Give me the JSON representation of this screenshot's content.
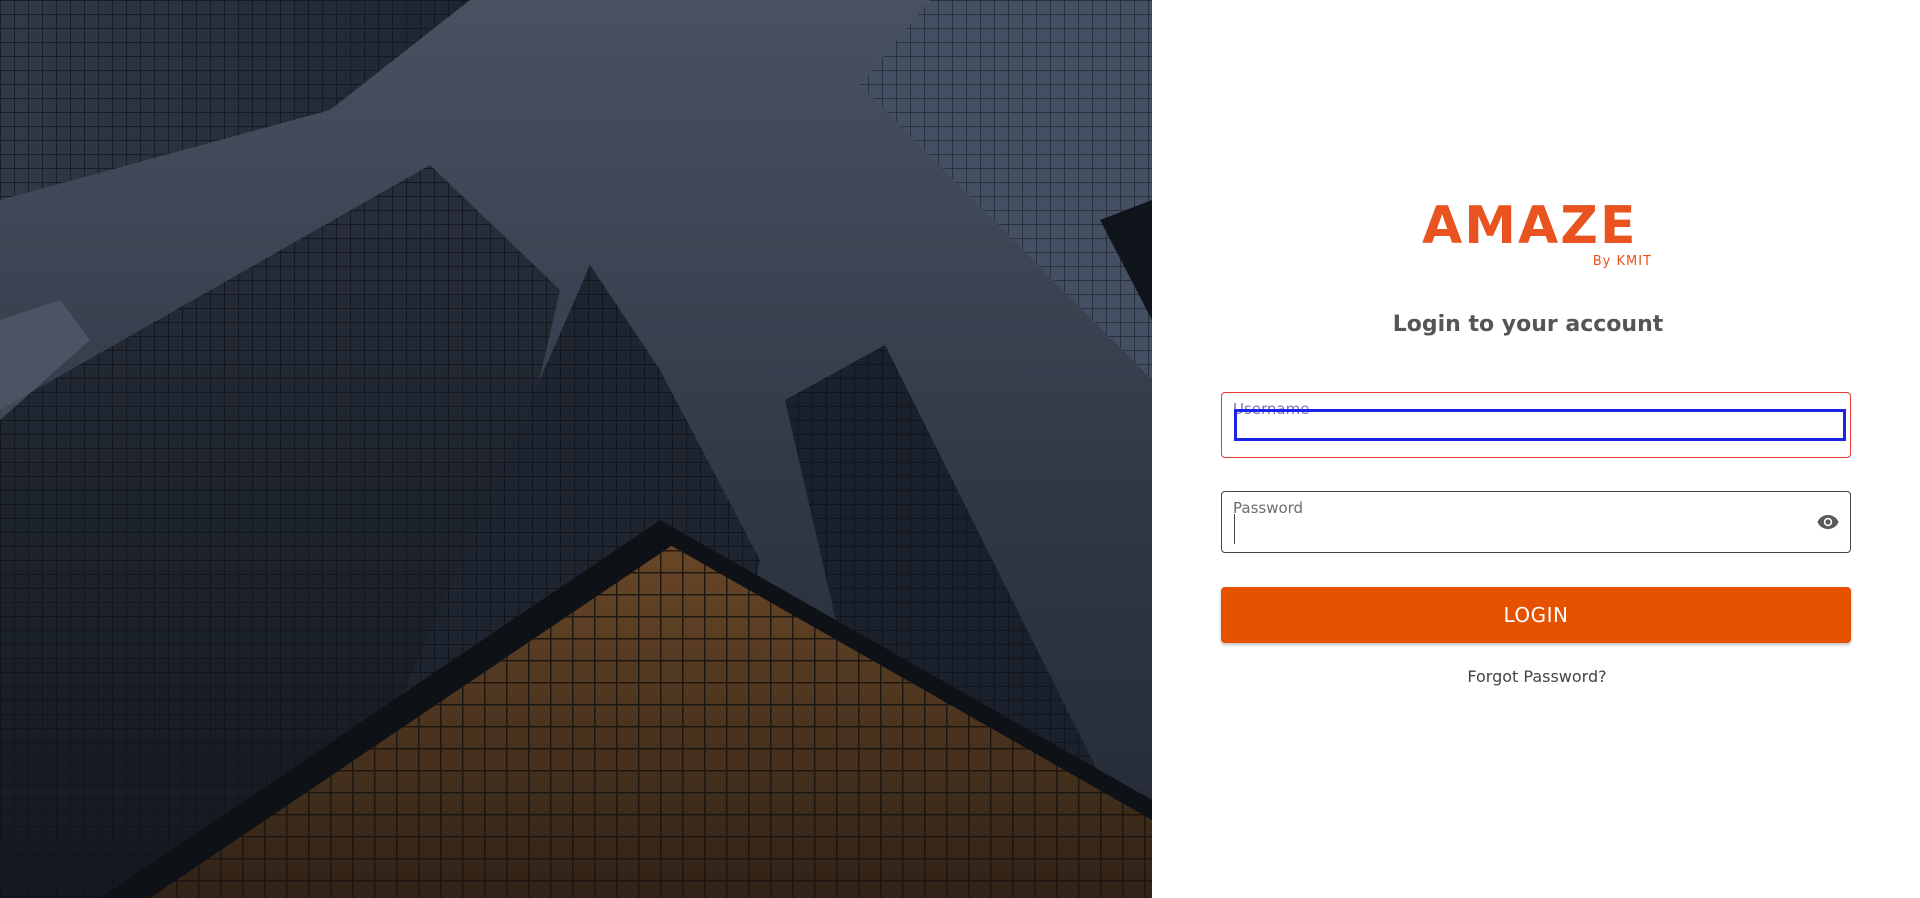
{
  "brand": {
    "name": "AMAZE",
    "byline": "By KMIT",
    "accent_color": "#e8531f"
  },
  "hero": {
    "image_alt": "skyscrapers photo"
  },
  "login": {
    "heading": "Login to your account",
    "username": {
      "label": "Username",
      "value": "",
      "error_border_color": "#e53935"
    },
    "password": {
      "label": "Password",
      "value": "",
      "visibility_icon": "eye-icon"
    },
    "submit_label": "LOGIN",
    "submit_color": "#e65100",
    "forgot_label": "Forgot Password?"
  }
}
